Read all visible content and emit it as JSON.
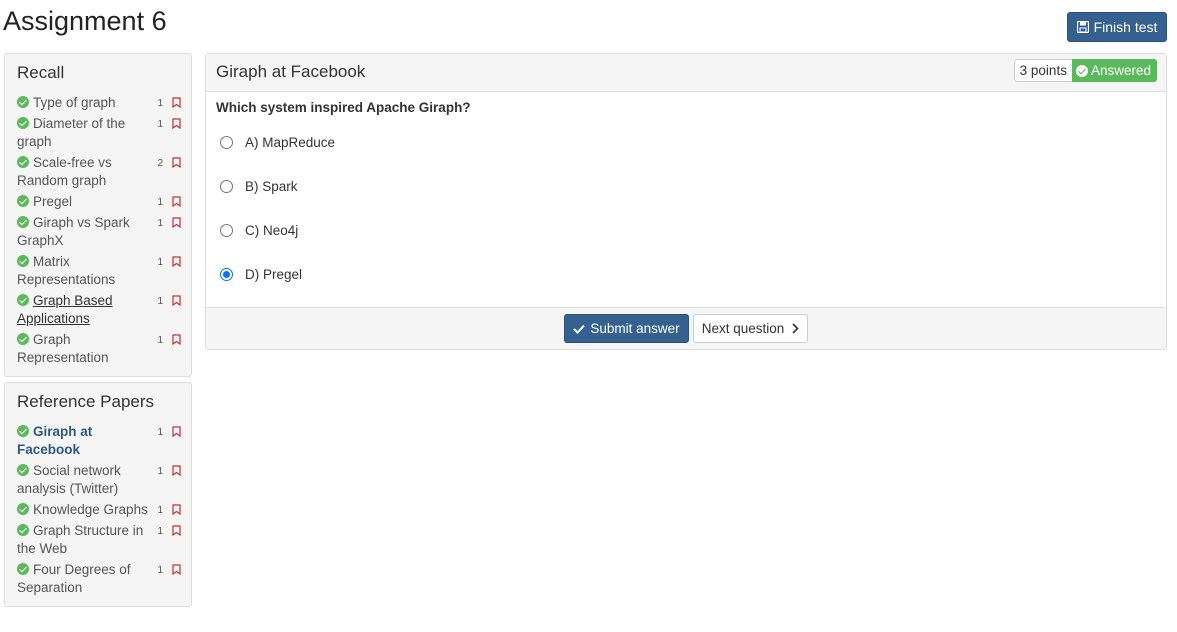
{
  "header": {
    "title": "Assignment 6",
    "finish_label": "Finish test"
  },
  "recall": {
    "title": "Recall",
    "items": [
      {
        "label": "Type of graph",
        "points": "1"
      },
      {
        "label": "Diameter of the graph",
        "points": "1"
      },
      {
        "label": "Scale-free vs Random graph",
        "points": "2"
      },
      {
        "label": "Pregel",
        "points": "1"
      },
      {
        "label": "Giraph vs Spark GraphX",
        "points": "1"
      },
      {
        "label": "Matrix Representations",
        "points": "1"
      },
      {
        "label": "Graph Based Applications",
        "points": "1"
      },
      {
        "label": "Graph Representation",
        "points": "1"
      }
    ]
  },
  "references": {
    "title": "Reference Papers",
    "items": [
      {
        "label": "Giraph at Facebook",
        "points": "1"
      },
      {
        "label": "Social network analysis (Twitter)",
        "points": "1"
      },
      {
        "label": "Knowledge Graphs",
        "points": "1"
      },
      {
        "label": "Graph Structure in the Web",
        "points": "1"
      },
      {
        "label": "Four Degrees of Separation",
        "points": "1"
      }
    ]
  },
  "question": {
    "title": "Giraph at Facebook",
    "points": "3 points",
    "status": "Answered",
    "text": "Which system inspired Apache Giraph?",
    "options": [
      {
        "label": "A) MapReduce",
        "selected": false
      },
      {
        "label": "B) Spark",
        "selected": false
      },
      {
        "label": "C) Neo4j",
        "selected": false
      },
      {
        "label": "D) Pregel",
        "selected": true
      }
    ],
    "submit_label": "Submit answer",
    "next_label": "Next question"
  },
  "colors": {
    "primary": "#34618f",
    "success": "#5cb85c",
    "bookmark": "#c9302c"
  }
}
